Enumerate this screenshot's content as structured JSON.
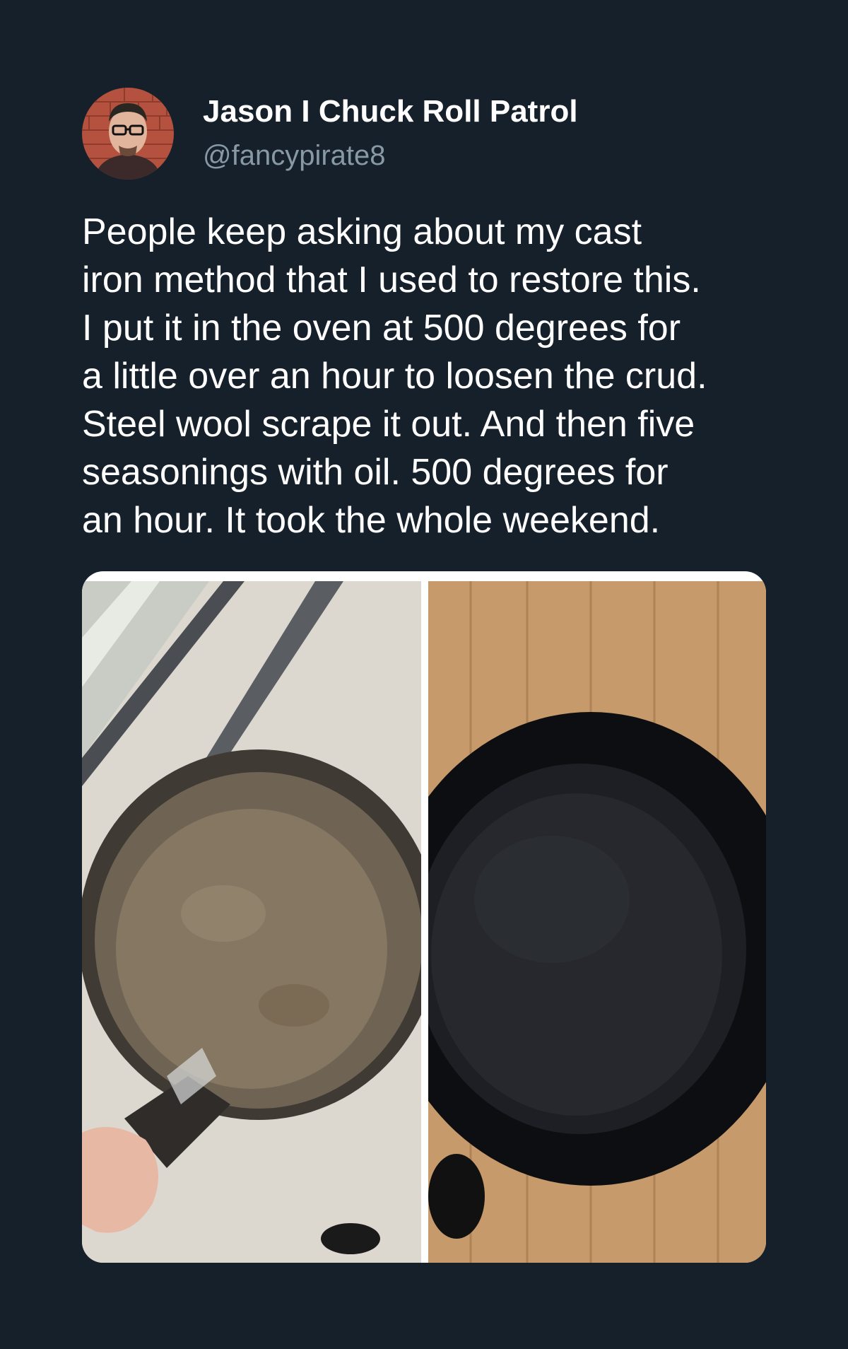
{
  "tweet": {
    "author": {
      "display_name": "Jason I Chuck Roll Patrol",
      "handle": "@fancypirate8"
    },
    "text": "People keep asking about my cast\niron method that I used to restore this.\nI put it in the oven at 500 degrees for\na little over an hour to loosen the crud.\nSteel wool scrape it out. And then five\nseasonings with oil. 500 degrees for\nan hour. It took the whole weekend.",
    "media": [
      {
        "name": "rusty-cast-iron-skillet-before"
      },
      {
        "name": "restored-cast-iron-skillet-after"
      }
    ]
  },
  "colors": {
    "background": "#15202b",
    "text_primary": "#ffffff",
    "text_secondary": "#8899a6"
  }
}
